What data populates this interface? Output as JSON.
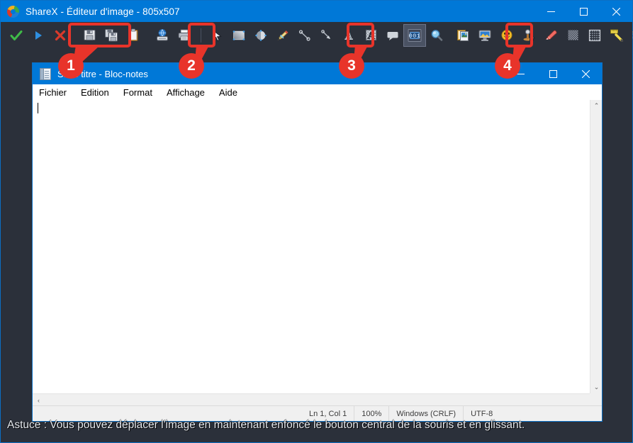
{
  "window": {
    "title": "ShareX - Éditeur d'image - 805x507",
    "logo_icon": "sharex-logo-icon",
    "minimize_icon": "minimize-icon",
    "maximize_icon": "maximize-icon",
    "close_icon": "close-icon"
  },
  "toolbar": {
    "items": [
      {
        "name": "accept-button",
        "icon": "checkmark-icon",
        "color": "#3fbb48"
      },
      {
        "name": "run-after-button",
        "icon": "play-triangle-icon",
        "color": "#2f8fe0"
      },
      {
        "name": "cancel-button",
        "icon": "red-x-icon",
        "color": "#d93a2b"
      },
      {
        "name": "save-image-button",
        "icon": "floppy-save-icon"
      },
      {
        "name": "save-image-as-button",
        "icon": "floppy-save-as-icon"
      },
      {
        "name": "copy-image-button",
        "icon": "clipboard-icon"
      },
      {
        "name": "upload-image-button",
        "icon": "upload-globe-icon"
      },
      {
        "name": "print-image-button",
        "icon": "printer-icon"
      },
      {
        "name": "select-tool",
        "icon": "cursor-arrow-icon"
      },
      {
        "name": "rectangle-tool",
        "icon": "rectangle-shape-icon"
      },
      {
        "name": "ellipse-tool",
        "icon": "ellipse-shape-icon"
      },
      {
        "name": "freehand-tool",
        "icon": "pencil-icon"
      },
      {
        "name": "line-tool",
        "icon": "line-icon"
      },
      {
        "name": "arrow-tool",
        "icon": "arrow-icon"
      },
      {
        "name": "text-outline-tool",
        "icon": "text-a-icon"
      },
      {
        "name": "text-background-tool",
        "icon": "text-a-background-icon"
      },
      {
        "name": "speech-balloon-tool",
        "icon": "speech-bubble-icon"
      },
      {
        "name": "step-counter-tool",
        "icon": "step-001-icon",
        "label": "001",
        "selected": true
      },
      {
        "name": "magnify-tool",
        "icon": "magnifier-icon"
      },
      {
        "name": "image-from-file-tool",
        "icon": "image-file-icon"
      },
      {
        "name": "image-from-screen-tool",
        "icon": "screen-monitor-icon"
      },
      {
        "name": "sticker-tool",
        "icon": "smiley-sticker-icon"
      },
      {
        "name": "cursor-stamp-tool",
        "icon": "cursor-stamp-icon"
      },
      {
        "name": "highlight-tool",
        "icon": "eraser-highlighter-icon"
      },
      {
        "name": "blur-tool",
        "icon": "blur-checker-icon"
      },
      {
        "name": "pixelate-tool",
        "icon": "pixelate-grid-icon"
      },
      {
        "name": "ruler-tool",
        "icon": "ruler-measure-icon"
      },
      {
        "name": "crop-tool",
        "icon": "crop-icon"
      },
      {
        "name": "border-color-swatch",
        "icon": "border-color-icon"
      },
      {
        "name": "fill-color-swatch",
        "icon": "fill-color-icon",
        "color": "#ee3e38"
      }
    ],
    "overflow_icon": "toolbar-overflow-chevron",
    "overflow_glyph": "≡"
  },
  "annotations": {
    "badges": [
      {
        "number": "1"
      },
      {
        "number": "2"
      },
      {
        "number": "3"
      },
      {
        "number": "4"
      }
    ],
    "highlight_color": "#e8342a"
  },
  "notepad": {
    "title": "Sans titre - Bloc-notes",
    "icon": "notepad-icon",
    "minimize_icon": "minimize-icon",
    "maximize_icon": "maximize-icon",
    "close_icon": "close-icon",
    "menus": [
      "Fichier",
      "Edition",
      "Format",
      "Affichage",
      "Aide"
    ],
    "text_content": "",
    "scrollbar": {
      "up_arrow": "⌃",
      "down_arrow": "⌄",
      "left_arrow": "‹",
      "right_arrow": "›"
    },
    "status": {
      "position": "Ln 1, Col 1",
      "zoom": "100%",
      "line_ending": "Windows (CRLF)",
      "encoding": "UTF-8"
    }
  },
  "tip": {
    "text": "Astuce : Vous pouvez déplacer l'image en maintenant enfoncé le bouton central de la souris et en glissant."
  }
}
